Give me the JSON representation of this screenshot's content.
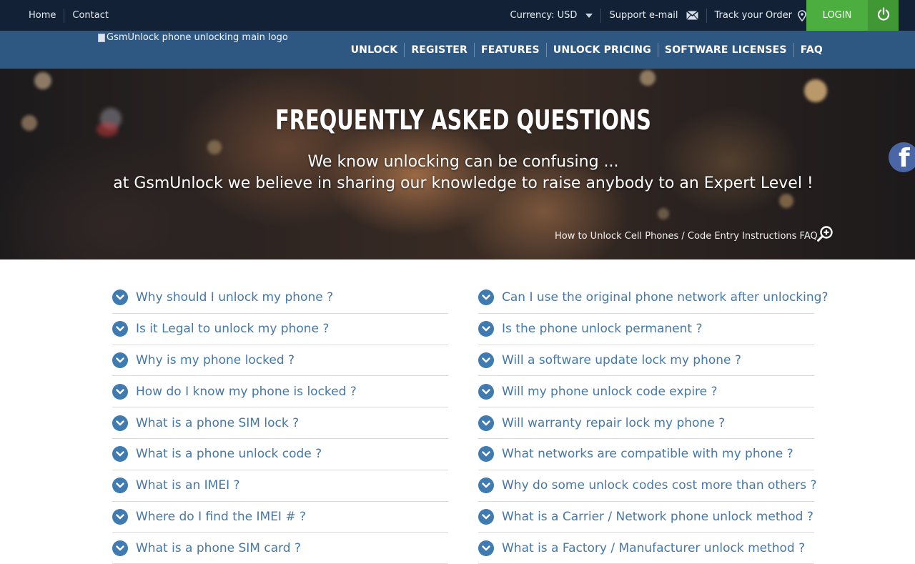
{
  "topbar": {
    "home": "Home",
    "contact": "Contact",
    "currency": "Currency: USD",
    "support": "Support e-mail",
    "track": "Track your Order",
    "login": "LOGIN"
  },
  "header": {
    "logo_alt": "GsmUnlock phone unlocking main logo",
    "nav": [
      "UNLOCK",
      "REGISTER",
      "FEATURES",
      "UNLOCK PRICING",
      "SOFTWARE LICENSES",
      "FAQ"
    ]
  },
  "hero": {
    "title": "FREQUENTLY ASKED QUESTIONS",
    "subtitle_line1": "We know unlocking can be confusing ...",
    "subtitle_line2": "at GsmUnlock we believe in sharing our knowledge to raise anybody to an Expert Level !",
    "link": "How to Unlock Cell Phones / Code Entry Instructions FAQ"
  },
  "faq": {
    "left": [
      "Why should I unlock my phone ?",
      "Is it Legal to unlock my phone ?",
      "Why is my phone locked ?",
      "How do I know my phone is locked ?",
      "What is a phone SIM lock ?",
      "What is a phone unlock code ?",
      "What is an IMEI ?",
      "Where do I find the IMEI # ?",
      "What is a phone SIM card ?"
    ],
    "right": [
      "Can I use the original phone network after unlocking?",
      "Is the phone unlock permanent ?",
      "Will a software update lock my phone ?",
      "Will my phone unlock code expire ?",
      "Will warranty repair lock my phone ?",
      "What networks are compatible with my phone ?",
      "Why do some unlock codes cost more than others ?",
      "What is a Carrier / Network phone unlock method ?",
      "What is a Factory / Manufacturer unlock method ?"
    ]
  },
  "icons": {
    "faq_chevron": "chevron-down-circle-icon",
    "support": "envelope-icon",
    "track": "map-pin-icon",
    "power": "power-icon",
    "facebook": "facebook-icon",
    "zoom": "zoom-plus-icon"
  },
  "colors": {
    "topbar_bg": "#122135",
    "nav_bg": "#2e5782",
    "login_bg": "#4cae3f",
    "faq_text": "#4578a8",
    "faq_icon": "#3f7bb0"
  }
}
